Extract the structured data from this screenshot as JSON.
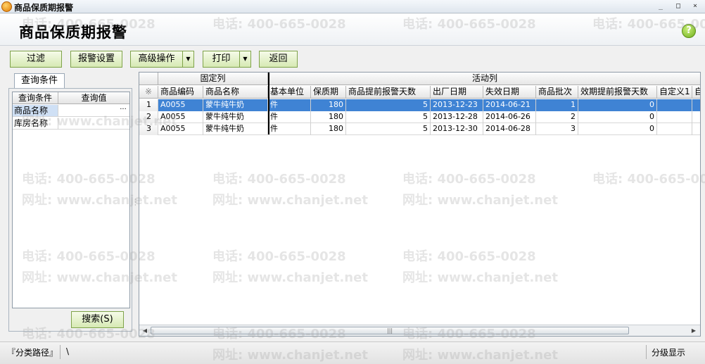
{
  "window": {
    "title": "商品保质期报警",
    "minimize": "_",
    "maximize": "□",
    "close": "×"
  },
  "header": {
    "title": "商品保质期报警",
    "help": "?"
  },
  "toolbar": {
    "filter": "过滤",
    "alarm_settings": "报警设置",
    "advanced": "高级操作",
    "print": "打印",
    "back": "返回"
  },
  "left_panel": {
    "tab": "查询条件",
    "headers": [
      "查询条件",
      "查询值"
    ],
    "rows": [
      {
        "label": "商品名称",
        "value": ""
      },
      {
        "label": "库房名称",
        "value": ""
      }
    ],
    "search_button": "搜索(S)"
  },
  "grid": {
    "groups": {
      "fixed": "固定列",
      "active": "活动列"
    },
    "corner": "※",
    "columns": [
      "商品编码",
      "商品名称",
      "基本单位",
      "保质期",
      "商品提前报警天数",
      "出厂日期",
      "失效日期",
      "商品批次",
      "效期提前报警天数",
      "自定义1",
      "自"
    ],
    "rows": [
      {
        "n": "1",
        "code": "A0055",
        "name": "蒙牛纯牛奶",
        "unit": "件",
        "shelf": "180",
        "warn": "5",
        "mfg": "2013-12-23",
        "exp": "2014-06-21",
        "batch": "1",
        "exp_warn": "0",
        "c1": ""
      },
      {
        "n": "2",
        "code": "A0055",
        "name": "蒙牛纯牛奶",
        "unit": "件",
        "shelf": "180",
        "warn": "5",
        "mfg": "2013-12-28",
        "exp": "2014-06-26",
        "batch": "2",
        "exp_warn": "0",
        "c1": ""
      },
      {
        "n": "3",
        "code": "A0055",
        "name": "蒙牛纯牛奶",
        "unit": "件",
        "shelf": "180",
        "warn": "5",
        "mfg": "2013-12-30",
        "exp": "2014-06-28",
        "batch": "3",
        "exp_warn": "0",
        "c1": ""
      }
    ],
    "selected_row": 1
  },
  "statusbar": {
    "category_path": "『分类路径』",
    "path_value": "\\",
    "level_display": "分级显示"
  },
  "watermark": {
    "phone": "电话: 400-665-0028",
    "site": "网址: www.chanjet.net"
  }
}
